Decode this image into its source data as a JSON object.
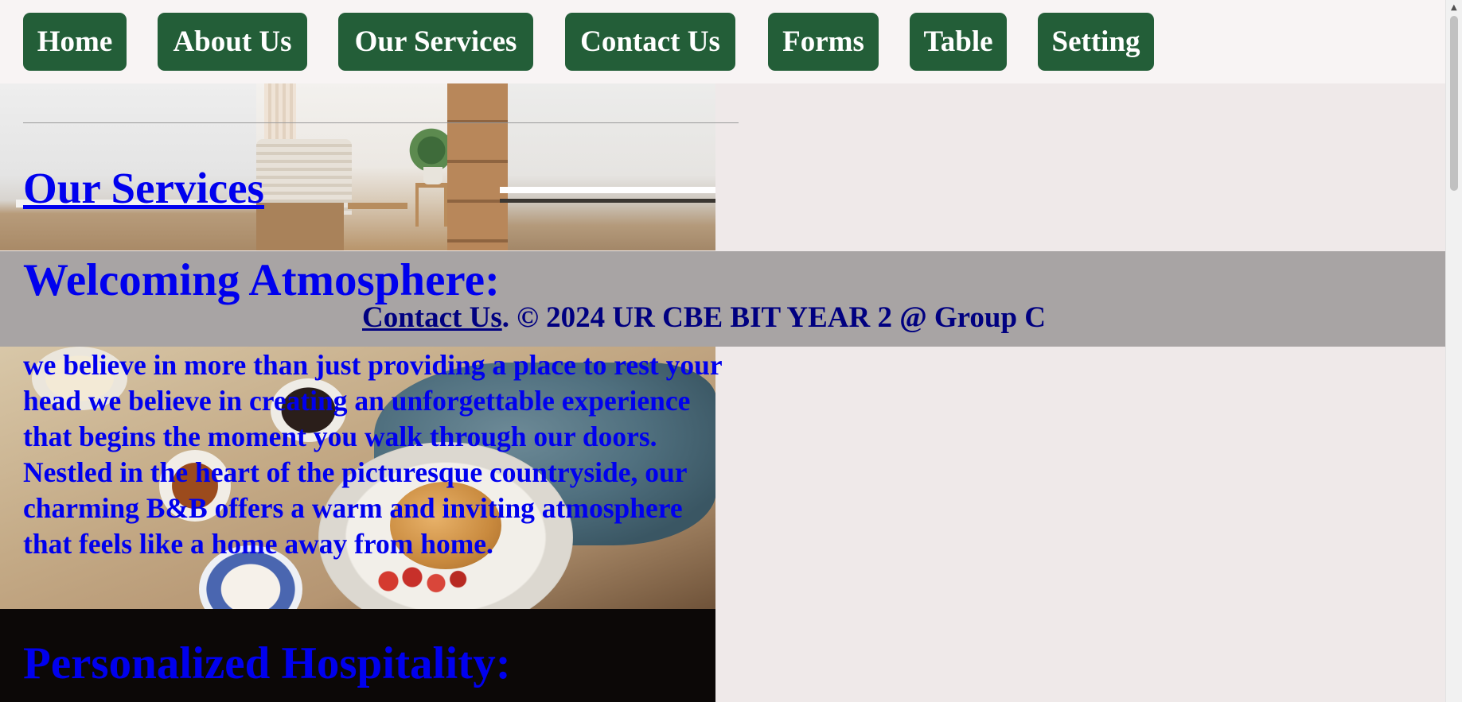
{
  "nav": {
    "items": [
      {
        "label": "Home"
      },
      {
        "label": "About Us"
      },
      {
        "label": "Our Services"
      },
      {
        "label": "Contact Us"
      },
      {
        "label": "Forms"
      },
      {
        "label": "Table"
      },
      {
        "label": "Setting"
      }
    ],
    "button_color": "#235e38"
  },
  "main": {
    "services_title": "Our Services",
    "welcome_title": "Welcoming Atmosphere:",
    "welcome_text": "we believe in more than just providing a place to rest your head we believe in creating an unforgettable experience that begins the moment you walk through our doors. Nestled in the heart of the picturesque countryside, our charming B&B offers a warm and inviting atmosphere that feels like a home away from home.",
    "hospitality_title": "Personalized Hospitality:",
    "text_color": "#0000ee"
  },
  "footer": {
    "link_label": "Contact Us",
    "copyright": ". © 2024 UR CBE BIT YEAR 2 @ Group C",
    "background": "#a8a4a4"
  },
  "icons": {
    "scroll_up": "scroll-up-arrow-icon"
  }
}
